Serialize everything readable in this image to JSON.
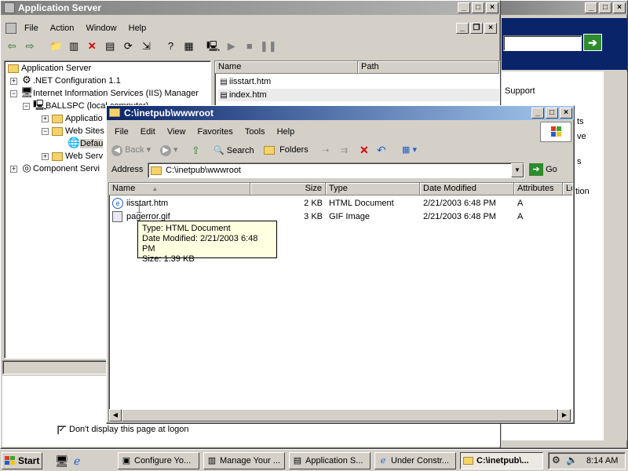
{
  "app_window": {
    "title": "Application Server",
    "menu": [
      "File",
      "Action",
      "Window",
      "Help"
    ],
    "tree": [
      {
        "label": "Application Server",
        "level": 0
      },
      {
        "label": ".NET Configuration 1.1",
        "level": 1
      },
      {
        "label": "Internet Information Services (IIS) Manager",
        "level": 1
      },
      {
        "label": "BALLSPC (local computer)",
        "level": 2
      },
      {
        "label": "Applicatio",
        "level": 3
      },
      {
        "label": "Web Sites",
        "level": 3
      },
      {
        "label": "Defau",
        "level": 4
      },
      {
        "label": "Web Serv",
        "level": 3
      },
      {
        "label": "Component Servi",
        "level": 1
      }
    ],
    "list_headers": {
      "name": "Name",
      "path": "Path"
    },
    "list_items": [
      "iisstart.htm",
      "index.htm"
    ],
    "logon_checkbox_label": "Don't display this page at logon",
    "logon_checked": true
  },
  "right_window": {
    "links": [
      "Support",
      "ts",
      "ve",
      "s",
      "tion"
    ]
  },
  "explorer": {
    "title": "C:\\inetpub\\wwwroot",
    "menu": [
      "File",
      "Edit",
      "View",
      "Favorites",
      "Tools",
      "Help"
    ],
    "toolbar": {
      "back": "Back",
      "search": "Search",
      "folders": "Folders"
    },
    "address_label": "Address",
    "address_value": "C:\\inetpub\\wwwroot",
    "go_label": "Go",
    "columns": [
      "Name",
      "Size",
      "Type",
      "Date Modified",
      "Attributes",
      "Lo"
    ],
    "files": [
      {
        "name": "iisstart.htm",
        "size": "2 KB",
        "type": "HTML Document",
        "modified": "2/21/2003 6:48 PM",
        "attr": "A"
      },
      {
        "name": "pagerror.gif",
        "size": "3 KB",
        "type": "GIF Image",
        "modified": "2/21/2003 6:48 PM",
        "attr": "A"
      }
    ],
    "tooltip": {
      "line1": "Type: HTML Document",
      "line2": "Date Modified: 2/21/2003 6:48 PM",
      "line3": "Size: 1.39 KB"
    }
  },
  "taskbar": {
    "start": "Start",
    "tasks": [
      "Configure Yo...",
      "Manage Your ...",
      "Application S...",
      "Under Constr...",
      "C:\\inetpub\\..."
    ],
    "clock": "8:14 AM"
  }
}
